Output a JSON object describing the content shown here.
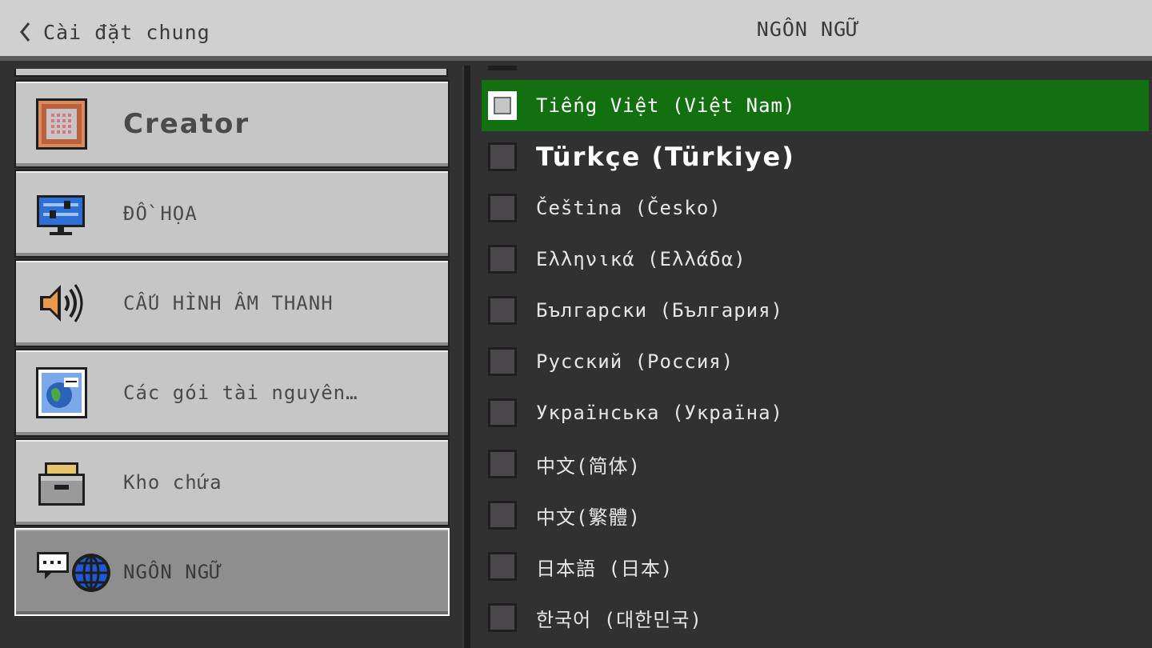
{
  "header": {
    "back_label": "Cài đặt chung",
    "title": "NGÔN NGỮ"
  },
  "sidebar": {
    "items": [
      {
        "label": "Creator",
        "icon": "command-block-icon"
      },
      {
        "label": "ĐỒ HỌA",
        "icon": "monitor-settings-icon"
      },
      {
        "label": "CẤU HÌNH ÂM THANH",
        "icon": "speaker-icon"
      },
      {
        "label": "Các gói tài nguyên…",
        "icon": "globe-pack-icon"
      },
      {
        "label": "Kho chứa",
        "icon": "storage-box-icon"
      },
      {
        "label": "NGÔN NGỮ",
        "icon": "language-globe-icon",
        "selected": true
      }
    ]
  },
  "languages": {
    "items": [
      {
        "label": "Tiếng Việt (Việt Nam)",
        "selected": true
      },
      {
        "label": "Türkçe (Türkiye)"
      },
      {
        "label": "Čeština (Česko)"
      },
      {
        "label": "Ελληνικά (Ελλάδα)"
      },
      {
        "label": "Български (България)"
      },
      {
        "label": "Русский (Россия)"
      },
      {
        "label": "Українська (Україна)"
      },
      {
        "label": "中文(简体)"
      },
      {
        "label": "中文(繁體)"
      },
      {
        "label": "日本語 (日本)"
      },
      {
        "label": "한국어 (대한민국)"
      }
    ]
  },
  "colors": {
    "header_bg": "#d0d0d0",
    "panel_bg": "#313131",
    "selected_row": "#137010",
    "nav_button": "#c6c6c6",
    "nav_selected": "#8e8e8e"
  }
}
